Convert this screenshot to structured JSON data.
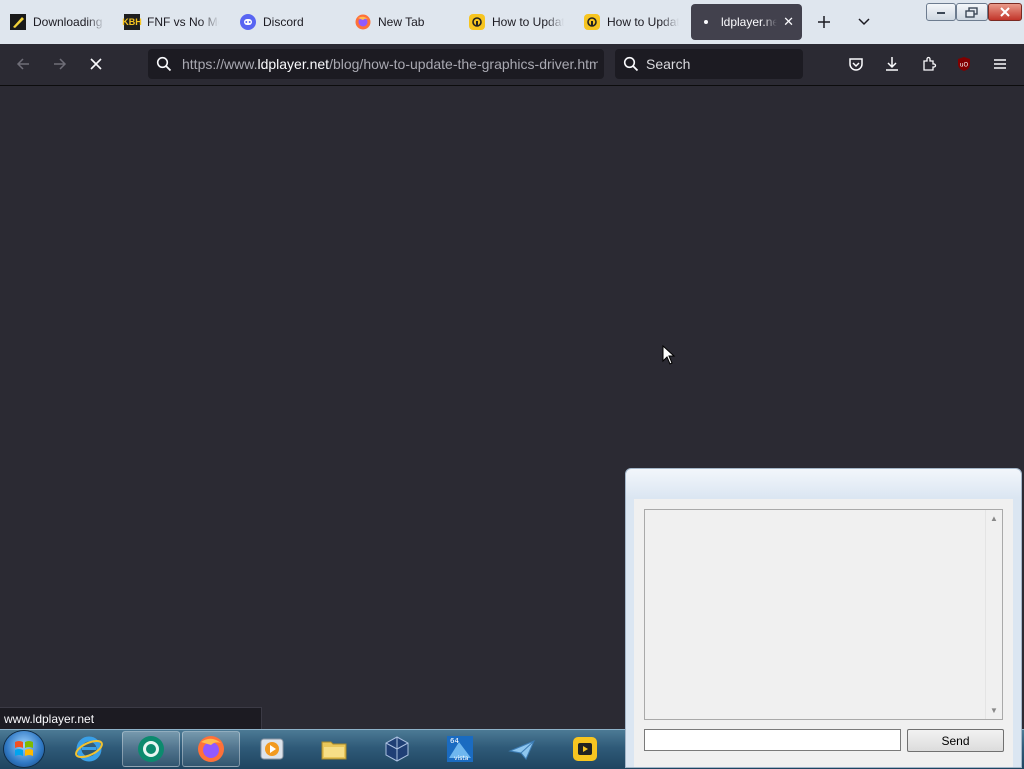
{
  "browser": {
    "tabs": [
      {
        "label": "Downloading",
        "icon": "download-page-icon",
        "active": false
      },
      {
        "label": "FNF vs No More",
        "icon": "kbh-games-icon",
        "active": false
      },
      {
        "label": "Discord",
        "icon": "discord-icon",
        "active": false
      },
      {
        "label": "New Tab",
        "icon": "firefox-icon",
        "active": false
      },
      {
        "label": "How to Update",
        "icon": "ldplayer-icon",
        "active": false
      },
      {
        "label": "How to Update",
        "icon": "ldplayer-icon",
        "active": false
      },
      {
        "label": "ldplayer.net",
        "icon": "loading-dot-icon",
        "active": true
      }
    ],
    "url": {
      "prefix": "https://www.",
      "host": "ldplayer.net",
      "path": "/blog/how-to-update-the-graphics-driver.html"
    },
    "search_placeholder": "Search",
    "status_text": "www.ldplayer.net"
  },
  "chat_window": {
    "send_label": "Send",
    "input_value": ""
  },
  "taskbar": {
    "items": [
      "start-orb",
      "internet-explorer",
      "app-green-circle",
      "firefox",
      "media-player",
      "file-explorer",
      "virtualbox",
      "vista-64",
      "plane-app",
      "ldplayer"
    ]
  },
  "colors": {
    "page_bg": "#2b2a33",
    "tabstrip_bg": "#dfe6ee",
    "active_tab": "#42414d",
    "url_bg": "#1c1b22"
  }
}
